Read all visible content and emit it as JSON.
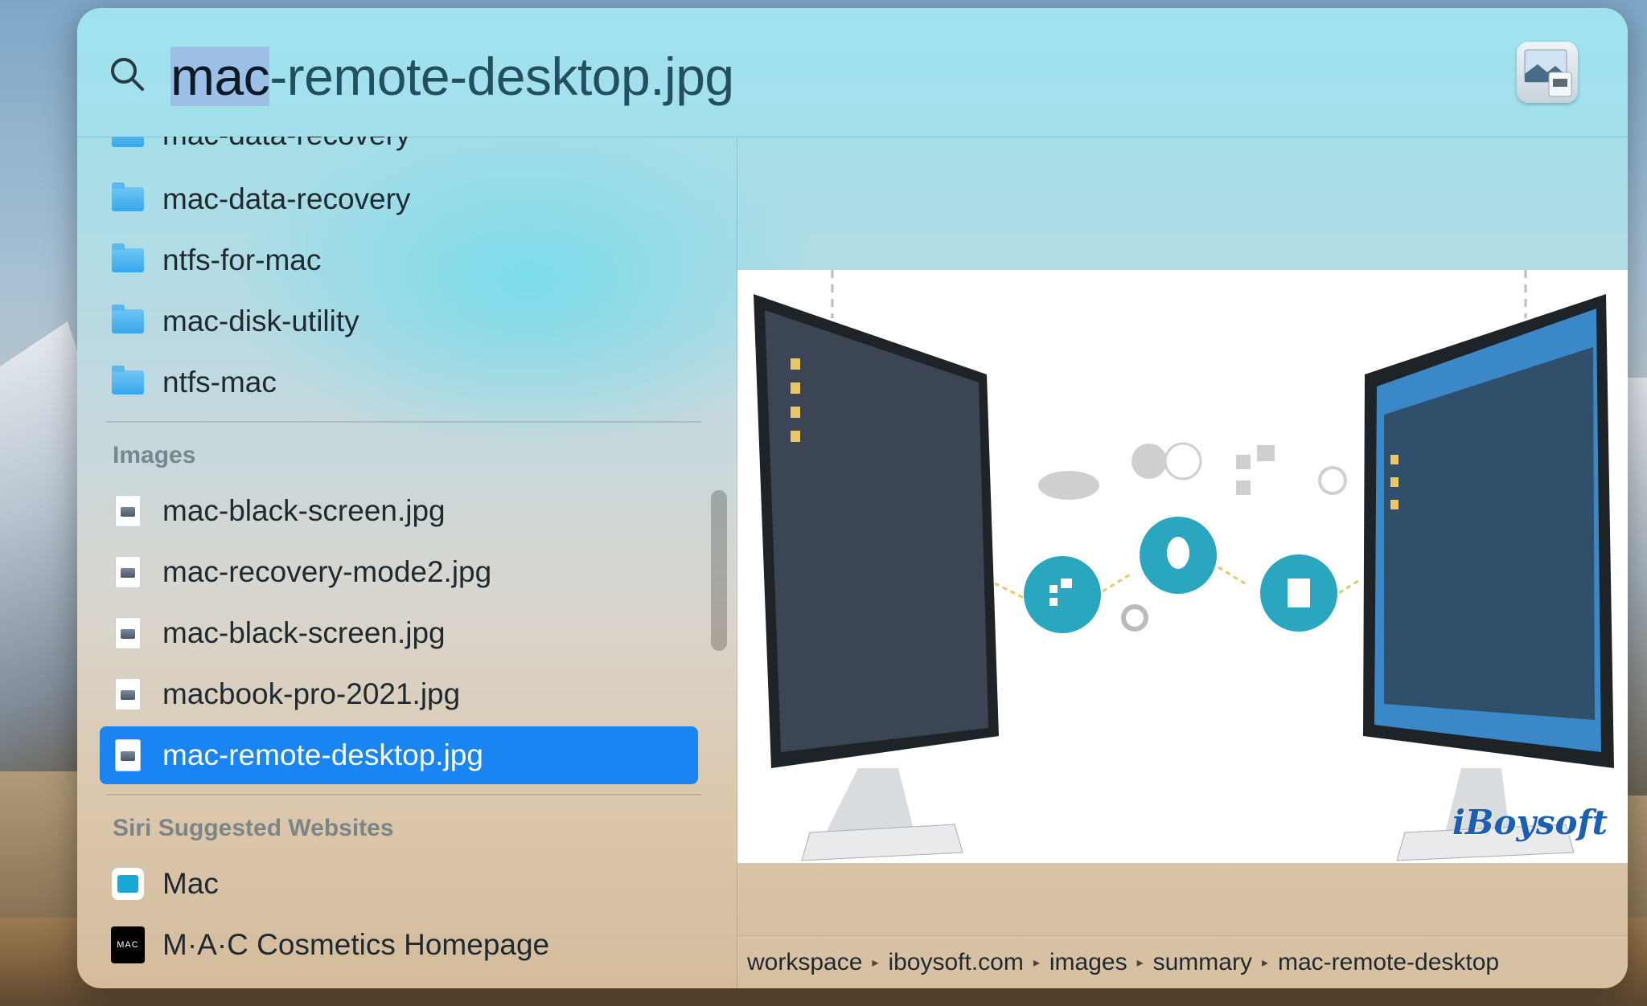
{
  "search": {
    "query_selected": "mac",
    "query_rest": "-remote-desktop.jpg"
  },
  "results": {
    "top_folders": [
      {
        "label": "mac-data-recovery"
      },
      {
        "label": "mac-data-recovery"
      },
      {
        "label": "ntfs-for-mac"
      },
      {
        "label": "mac-disk-utility"
      },
      {
        "label": "ntfs-mac"
      }
    ],
    "images_header": "Images",
    "images": [
      {
        "label": "mac-black-screen.jpg"
      },
      {
        "label": "mac-recovery-mode2.jpg"
      },
      {
        "label": "mac-black-screen.jpg"
      },
      {
        "label": "macbook-pro-2021.jpg"
      },
      {
        "label": "mac-remote-desktop.jpg"
      }
    ],
    "selected_index": 4,
    "siri_header": "Siri Suggested Websites",
    "websites": [
      {
        "label": "Mac",
        "icon": "safari-bookmark-icon"
      },
      {
        "label": "M·A·C Cosmetics Homepage",
        "icon": "mac-cosmetics-icon"
      }
    ]
  },
  "preview": {
    "watermark": "iBoysoft",
    "path": [
      "workspace",
      "iboysoft.com",
      "images",
      "summary",
      "mac-remote-desktop"
    ]
  },
  "colors": {
    "selection": "#1a84f2",
    "accent_teal": "#2aa7bf"
  }
}
